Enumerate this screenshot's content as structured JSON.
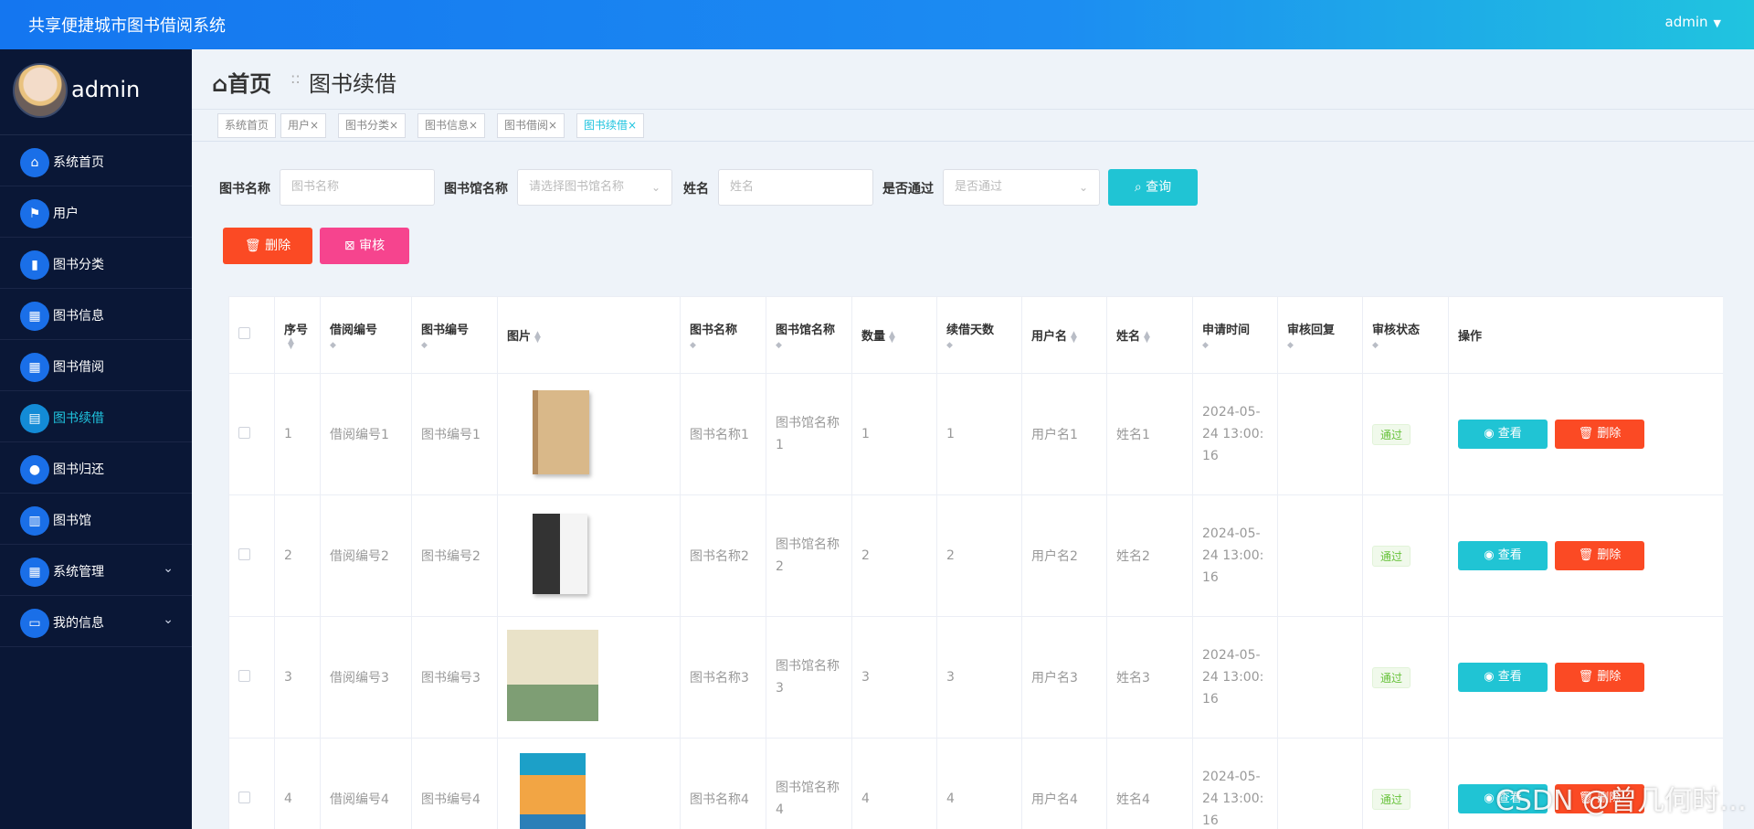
{
  "app": {
    "title": "共享便捷城市图书借阅系统",
    "user": "admin"
  },
  "sidebar": {
    "username": "admin",
    "items": [
      {
        "label": "系统首页",
        "icon": "home-icon"
      },
      {
        "label": "用户",
        "icon": "flag-icon"
      },
      {
        "label": "图书分类",
        "icon": "book-icon"
      },
      {
        "label": "图书信息",
        "icon": "grid-icon"
      },
      {
        "label": "图书借阅",
        "icon": "grid-icon"
      },
      {
        "label": "图书续借",
        "icon": "clipboard-icon",
        "active": true
      },
      {
        "label": "图书归还",
        "icon": "user-icon"
      },
      {
        "label": "图书馆",
        "icon": "bar-chart-icon"
      },
      {
        "label": "系统管理",
        "icon": "grid-icon",
        "expandable": true
      },
      {
        "label": "我的信息",
        "icon": "wallet-icon",
        "expandable": true
      }
    ]
  },
  "breadcrumb": {
    "home": "首页",
    "separator": "::",
    "current": "图书续借"
  },
  "tabs": [
    {
      "label": "系统首页",
      "closable": false
    },
    {
      "label": "用户",
      "closable": true
    },
    {
      "label": "图书分类",
      "closable": true
    },
    {
      "label": "图书信息",
      "closable": true
    },
    {
      "label": "图书借阅",
      "closable": true
    },
    {
      "label": "图书续借",
      "closable": true,
      "active": true
    }
  ],
  "search": {
    "book_name_label": "图书名称",
    "book_name_placeholder": "图书名称",
    "library_label": "图书馆名称",
    "library_placeholder": "请选择图书馆名称",
    "name_label": "姓名",
    "name_placeholder": "姓名",
    "passed_label": "是否通过",
    "passed_placeholder": "是否通过",
    "query_button": "查询"
  },
  "actions": {
    "delete": "删除",
    "audit": "审核"
  },
  "table": {
    "columns": [
      "序号",
      "借阅编号",
      "图书编号",
      "图片",
      "图书名称",
      "图书馆名称",
      "数量",
      "续借天数",
      "用户名",
      "姓名",
      "申请时间",
      "审核回复",
      "审核状态",
      "操作"
    ],
    "rows": [
      {
        "no": "1",
        "borrow_no": "借阅编号1",
        "book_no": "图书编号1",
        "book_name": "图书名称1",
        "library": "图书馆名称1",
        "qty": "1",
        "days": "1",
        "username": "用户名1",
        "name": "姓名1",
        "time": "2024-05-24 13:00:16",
        "reply": "",
        "status": "通过"
      },
      {
        "no": "2",
        "borrow_no": "借阅编号2",
        "book_no": "图书编号2",
        "book_name": "图书名称2",
        "library": "图书馆名称2",
        "qty": "2",
        "days": "2",
        "username": "用户名2",
        "name": "姓名2",
        "time": "2024-05-24 13:00:16",
        "reply": "",
        "status": "通过"
      },
      {
        "no": "3",
        "borrow_no": "借阅编号3",
        "book_no": "图书编号3",
        "book_name": "图书名称3",
        "library": "图书馆名称3",
        "qty": "3",
        "days": "3",
        "username": "用户名3",
        "name": "姓名3",
        "time": "2024-05-24 13:00:16",
        "reply": "",
        "status": "通过"
      },
      {
        "no": "4",
        "borrow_no": "借阅编号4",
        "book_no": "图书编号4",
        "book_name": "图书名称4",
        "library": "图书馆名称4",
        "qty": "4",
        "days": "4",
        "username": "用户名4",
        "name": "姓名4",
        "time": "2024-05-24 13:00:16",
        "reply": "",
        "status": "通过"
      }
    ],
    "view_button": "查看",
    "delete_button": "删除"
  },
  "watermark": "CSDN @曾几何时…",
  "colors": {
    "primary": "#1476f0",
    "sidebar_bg": "#0a1736",
    "accent_cyan": "#20c4d4",
    "danger": "#fb4a24",
    "pink": "#f6448e",
    "success": "#67c23a"
  }
}
